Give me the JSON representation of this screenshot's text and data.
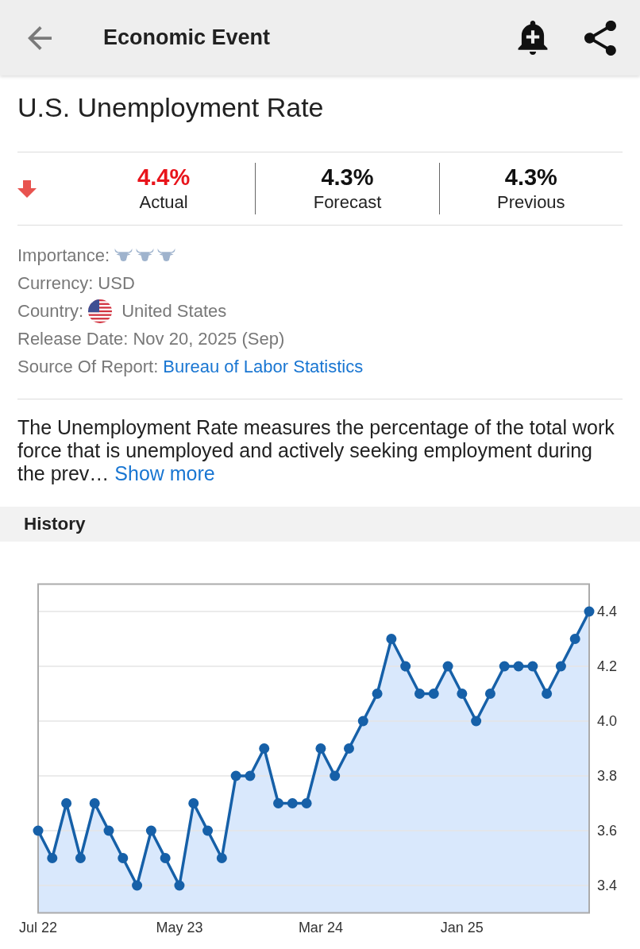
{
  "app_bar": {
    "title": "Economic Event"
  },
  "event": {
    "title": "U.S. Unemployment Rate"
  },
  "summary": {
    "down": true,
    "figures": [
      {
        "value": "4.4%",
        "label": "Actual",
        "color": "#e8141b"
      },
      {
        "value": "4.3%",
        "label": "Forecast",
        "color": "#111111"
      },
      {
        "value": "4.3%",
        "label": "Previous",
        "color": "#111111"
      }
    ]
  },
  "details": [
    {
      "kind": "importance",
      "label": "Importance:",
      "stars": 3
    },
    {
      "kind": "text",
      "label": "Currency:",
      "value": "USD"
    },
    {
      "kind": "country",
      "label": "Country:",
      "value": "United States"
    },
    {
      "kind": "text",
      "label": "Release Date:",
      "value": "Nov 20, 2025 (Sep)"
    },
    {
      "kind": "link",
      "label": "Source Of Report:",
      "value": "Bureau of Labor Statistics"
    }
  ],
  "description": {
    "text": "The Unemployment Rate measures the percentage of the total work force that is unemployed and actively seeking employment during the prev…",
    "link": "Show more"
  },
  "history": {
    "title": "History",
    "chart_data": {
      "type": "area",
      "grid": true,
      "categories": [
        "Jul 22",
        null,
        null,
        null,
        null,
        null,
        null,
        null,
        null,
        null,
        "May 23",
        null,
        null,
        null,
        null,
        null,
        null,
        null,
        null,
        null,
        "Mar 24",
        null,
        null,
        null,
        null,
        null,
        null,
        null,
        null,
        null,
        "Jan 25",
        null,
        null,
        null,
        null,
        null,
        null,
        null,
        null,
        null
      ],
      "ylim": [
        3.3,
        4.5
      ],
      "yticks": [
        {
          "value": 3.4,
          "label": "3.4"
        },
        {
          "value": 3.6,
          "label": "3.6"
        },
        {
          "value": 3.8,
          "label": "3.8"
        },
        {
          "value": 4.0,
          "label": "4.0"
        },
        {
          "value": 4.2,
          "label": "4.2"
        },
        {
          "value": 4.4,
          "label": "4.4"
        }
      ],
      "series": [
        {
          "color": "#1660a8",
          "values": [
            3.6,
            3.5,
            3.7,
            3.5,
            3.7,
            3.6,
            3.5,
            3.4,
            3.6,
            3.5,
            3.4,
            3.7,
            3.6,
            3.5,
            3.8,
            3.8,
            3.9,
            3.7,
            3.7,
            3.7,
            3.9,
            3.8,
            3.9,
            4.0,
            4.1,
            4.3,
            4.2,
            4.1,
            4.1,
            4.2,
            4.1,
            4.0,
            4.1,
            4.2,
            4.2,
            4.2,
            4.1,
            4.2,
            4.3,
            4.4
          ]
        }
      ]
    }
  }
}
